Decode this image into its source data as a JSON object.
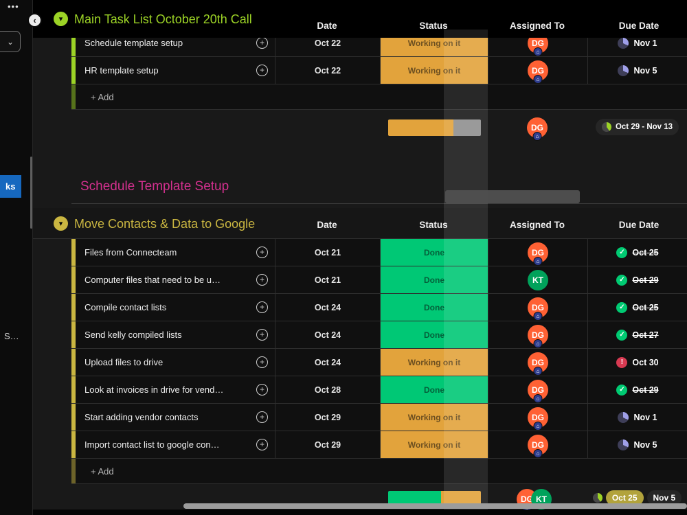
{
  "sidebar": {
    "menu_icon": "•••",
    "collapse_icon": "‹",
    "dropdown_icon": "⌄",
    "active_item_label": "ks",
    "secondary_item_label": "S…"
  },
  "columns": {
    "date": "Date",
    "status": "Status",
    "assigned": "Assigned To",
    "due": "Due Date"
  },
  "icons": {
    "group_chevron": "▾",
    "add_update": "+",
    "home_badge": "⌂",
    "check": "✓",
    "alert": "!"
  },
  "status_colors": {
    "Working on it": "#e2a33c",
    "Done": "#00c875"
  },
  "avatar_colors": {
    "DG": "#ff6134",
    "KT": "#00a25b"
  },
  "groups": [
    {
      "title": "Main Task List October 20th Call",
      "color": "#9cd326",
      "add_label": "+ Add",
      "tasks": [
        {
          "name": "Schedule template setup",
          "date": "Oct 22",
          "status": "Working on it",
          "assignee": "DG",
          "due": "Nov 1",
          "due_icon": "pie-purple"
        },
        {
          "name": "HR template setup",
          "date": "Oct 22",
          "status": "Working on it",
          "assignee": "DG",
          "due": "Nov 5",
          "due_icon": "pie-purple"
        }
      ],
      "summary": {
        "progress": [
          {
            "status": "Working on it",
            "color": "#e2a33c",
            "pct": 70
          },
          {
            "status": "empty",
            "color": "#8f8f8f",
            "pct": 30
          }
        ],
        "assignees": [
          "DG"
        ],
        "due_range": "Oct 29 - Nov 13"
      }
    },
    {
      "title": "Schedule Template Setup",
      "color": "#d4308f"
    },
    {
      "title": "Move Contacts & Data to Google",
      "color": "#cab641",
      "add_label": "+ Add",
      "tasks": [
        {
          "name": "Files from Connecteam",
          "date": "Oct 21",
          "status": "Done",
          "assignee": "DG",
          "due": "Oct 25",
          "due_icon": "check",
          "done": true
        },
        {
          "name": "Computer files that need to be u…",
          "date": "Oct 21",
          "status": "Done",
          "assignee": "KT",
          "due": "Oct 29",
          "due_icon": "check",
          "done": true
        },
        {
          "name": "Compile contact lists",
          "date": "Oct 24",
          "status": "Done",
          "assignee": "DG",
          "due": "Oct 25",
          "due_icon": "check",
          "done": true
        },
        {
          "name": "Send kelly compiled lists",
          "date": "Oct 24",
          "status": "Done",
          "assignee": "DG",
          "due": "Oct 27",
          "due_icon": "check",
          "done": true
        },
        {
          "name": "Upload files to drive",
          "date": "Oct 24",
          "status": "Working on it",
          "assignee": "DG",
          "due": "Oct 30",
          "due_icon": "alert"
        },
        {
          "name": "Look at invoices in drive for vend…",
          "date": "Oct 28",
          "status": "Done",
          "assignee": "DG",
          "due": "Oct 29",
          "due_icon": "check",
          "done": true
        },
        {
          "name": "Start adding vendor contacts",
          "date": "Oct 29",
          "status": "Working on it",
          "assignee": "DG",
          "due": "Nov 1",
          "due_icon": "pie-purple"
        },
        {
          "name": "Import contact list to google con…",
          "date": "Oct 29",
          "status": "Working on it",
          "assignee": "DG",
          "due": "Nov 5",
          "due_icon": "pie-purple"
        }
      ],
      "summary": {
        "progress": [
          {
            "status": "Done",
            "color": "#00c875",
            "pct": 57
          },
          {
            "status": "Working on it",
            "color": "#e2a33c",
            "pct": 43
          }
        ],
        "assignees": [
          "DG",
          "KT"
        ],
        "due_badges": [
          "Oct 25",
          "Nov 5"
        ]
      }
    }
  ]
}
